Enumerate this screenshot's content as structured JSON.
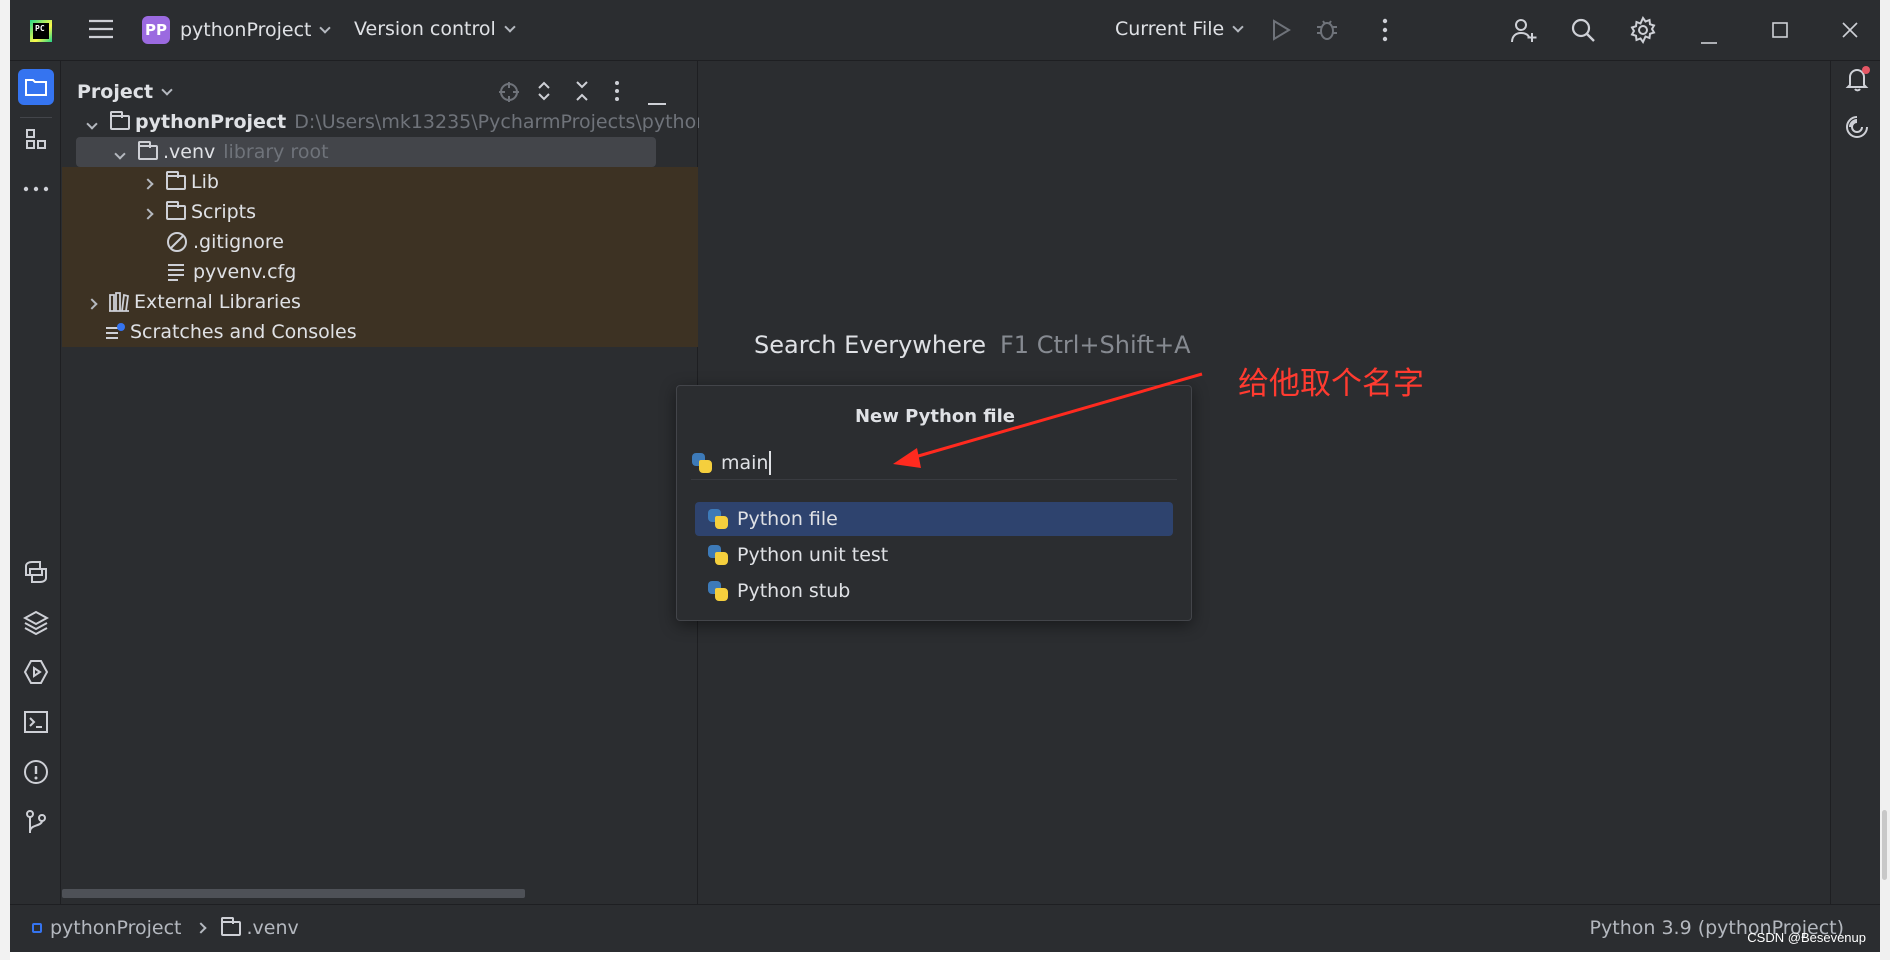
{
  "titlebar": {
    "logo_text": "PC",
    "project_badge": "PP",
    "project_name": "pythonProject",
    "vcs_label": "Version control",
    "run_config": "Current File"
  },
  "project_panel": {
    "title": "Project",
    "tree": {
      "root_name": "pythonProject",
      "root_path": "D:\\Users\\mk13235\\PycharmProjects\\pythonPr",
      "venv_name": ".venv",
      "venv_hint": "library root",
      "lib": "Lib",
      "scripts": "Scripts",
      "gitignore": ".gitignore",
      "pyvenv": "pyvenv.cfg",
      "external": "External Libraries",
      "scratches": "Scratches and Consoles"
    }
  },
  "editor": {
    "search_label": "Search Everywhere",
    "search_shortcut": "F1 Ctrl+Shift+A"
  },
  "popup": {
    "title": "New Python file",
    "input_value": "main",
    "items": [
      {
        "label": "Python file",
        "selected": true
      },
      {
        "label": "Python unit test",
        "selected": false
      },
      {
        "label": "Python stub",
        "selected": false
      }
    ]
  },
  "annotation": {
    "text": "给他取个名字",
    "color": "#ff3b30"
  },
  "statusbar": {
    "crumb_project": "pythonProject",
    "crumb_folder": ".venv",
    "interpreter": "Python 3.9 (pythonProject)",
    "watermark": "CSDN @Besevenup"
  },
  "colors": {
    "background": "#2b2d30",
    "selection": "#2e436e",
    "accent": "#3574f0",
    "badge": "#9b6ae0",
    "venv_highlight": "#3d3223"
  }
}
